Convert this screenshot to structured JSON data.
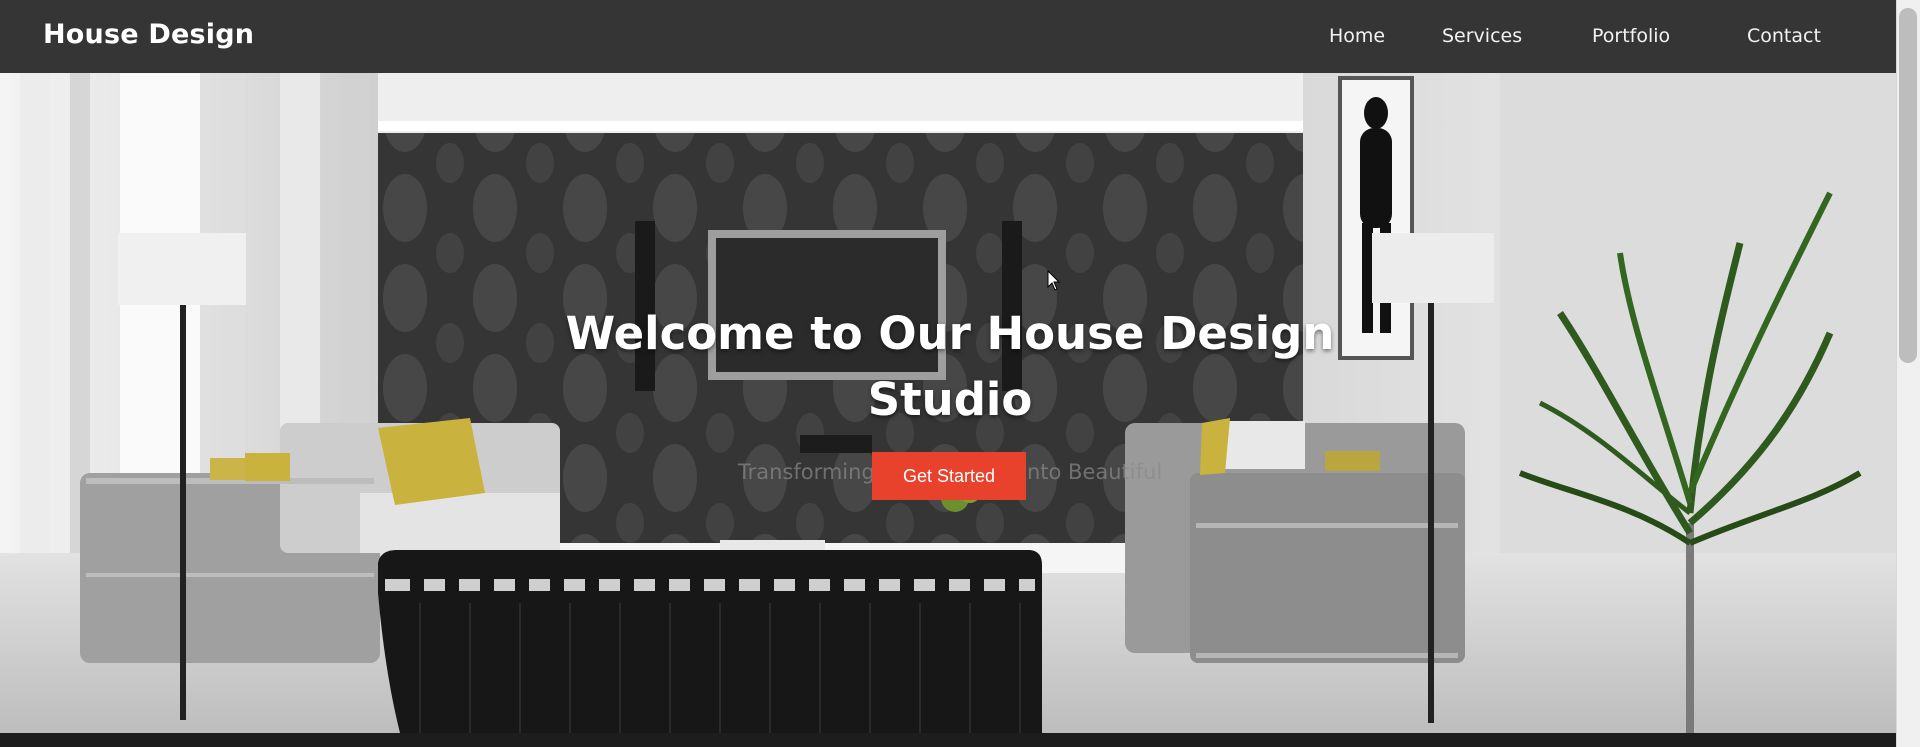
{
  "navbar": {
    "brand": "House Design",
    "links": [
      "Home",
      "Services",
      "Portfolio",
      "Contact"
    ]
  },
  "hero": {
    "title": "Welcome to Our House Design Studio",
    "subtitle": "Transforming Your Dreams into Beautiful",
    "cta_label": "Get Started"
  },
  "colors": {
    "navbar": "#353535",
    "cta": "#e8412c",
    "text": "#ffffff"
  },
  "icons": {
    "cursor": "mouse-pointer-icon"
  }
}
